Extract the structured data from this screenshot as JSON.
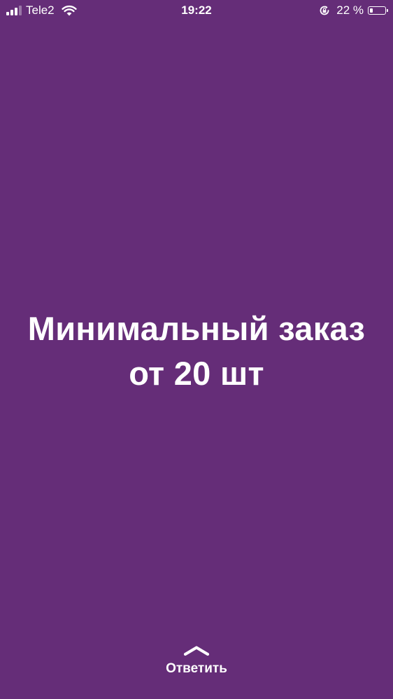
{
  "status_bar": {
    "carrier": "Tele2",
    "time": "19:22",
    "battery_percent": "22 %",
    "battery_level": 0.22,
    "signal_bars_active": 3,
    "signal_bars_total": 4,
    "icons": [
      "signal-icon",
      "wifi-icon",
      "orientation-lock-icon",
      "battery-icon"
    ]
  },
  "story": {
    "line1": "Минимальный заказ",
    "line2": "от 20 шт",
    "background_color": "#652d78",
    "text_color": "#ffffff"
  },
  "reply": {
    "label": "Ответить",
    "icon": "chevron-up-icon"
  }
}
